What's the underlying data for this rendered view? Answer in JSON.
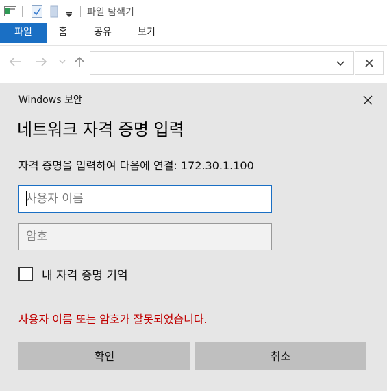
{
  "explorer": {
    "title": "파일 탐색기",
    "ribbon_tabs": [
      "파일",
      "홈",
      "공유",
      "보기"
    ],
    "address_value": "",
    "icons": {
      "app": "file-explorer-icon",
      "properties": "properties-check-icon",
      "new_folder": "new-folder-icon",
      "customize": "quick-access-dropdown-icon",
      "back": "back-arrow-icon",
      "forward": "forward-arrow-icon",
      "recent": "recent-locations-chevron-icon",
      "up": "up-arrow-icon",
      "address_dropdown": "chevron-down-icon",
      "address_clear": "close-icon"
    },
    "accent_color": "#1a6fc4"
  },
  "dialog": {
    "caption": "Windows 보안",
    "title": "네트워크 자격 증명 입력",
    "message": "자격 증명을 입력하여 다음에 연결: 172.30.1.100",
    "username": {
      "value": "",
      "placeholder": "사용자 이름"
    },
    "password": {
      "value": "",
      "placeholder": "암호"
    },
    "remember_label": "내 자격 증명 기억",
    "remember_checked": false,
    "error": "사용자 이름 또는 암호가 잘못되었습니다.",
    "ok_label": "확인",
    "cancel_label": "취소",
    "error_color": "#c00000"
  }
}
